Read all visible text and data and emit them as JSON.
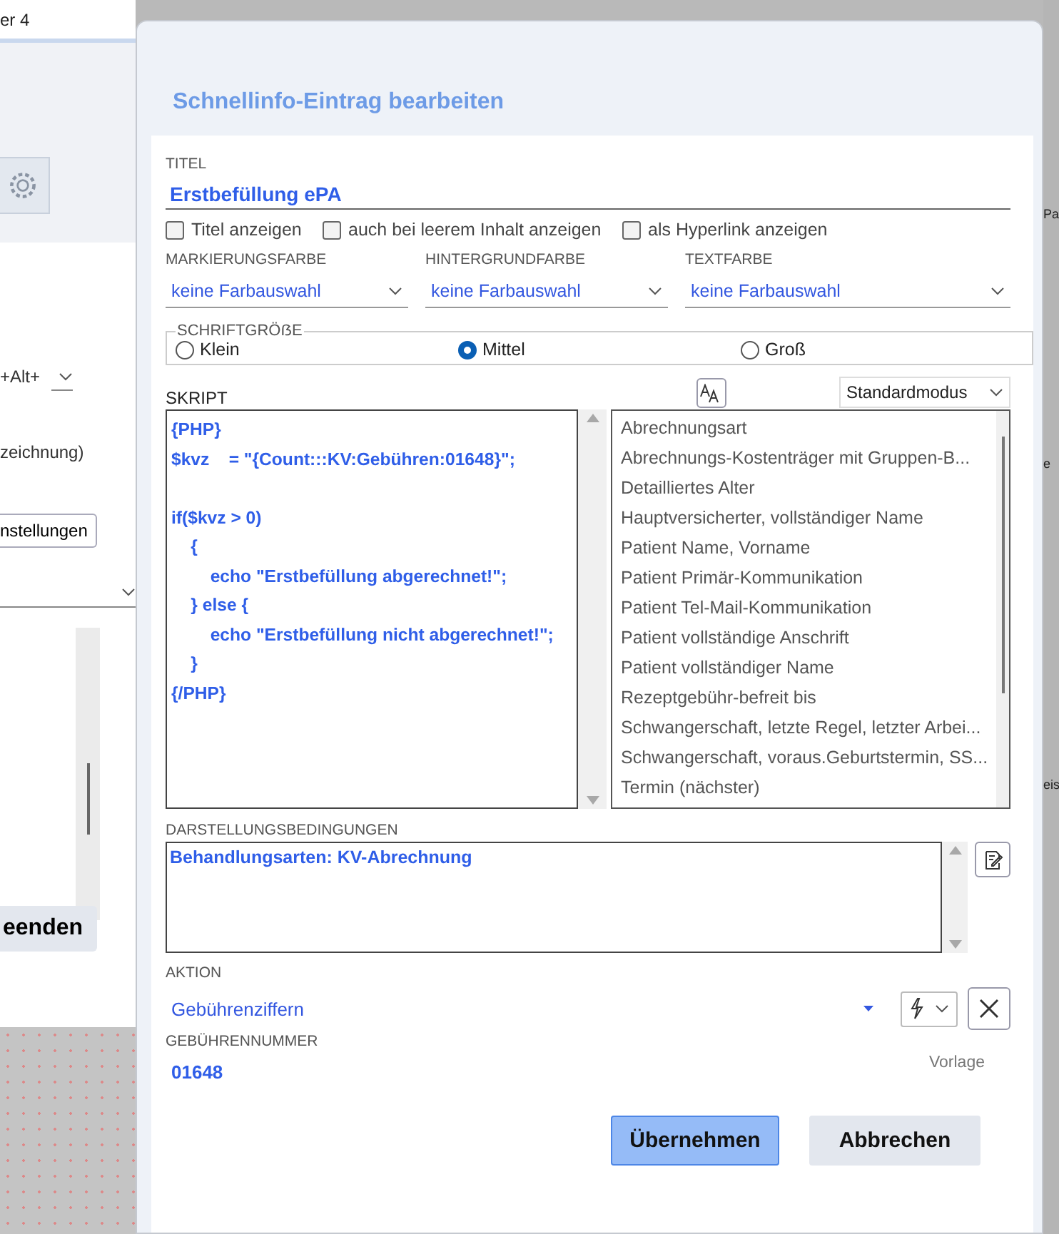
{
  "background_window": {
    "title": "er 4",
    "shortcut_label": "+Alt+",
    "label": "zeichnung)",
    "button": "nstellungen",
    "end_button": "eenden"
  },
  "right_edge_texts": [
    "Pa",
    "e",
    "eis"
  ],
  "dialog": {
    "title": "Schnellinfo-Eintrag bearbeiten",
    "titel": {
      "label": "TITEL",
      "value": "Erstbefüllung ePA"
    },
    "checkboxes": [
      {
        "label": "Titel anzeigen",
        "checked": false
      },
      {
        "label": "auch bei leerem Inhalt anzeigen",
        "checked": false
      },
      {
        "label": "als Hyperlink anzeigen",
        "checked": false
      }
    ],
    "color_selects": [
      {
        "label": "MARKIERUNGSFARBE",
        "value": "keine Farbauswahl"
      },
      {
        "label": "HINTERGRUNDFARBE",
        "value": "keine Farbauswahl"
      },
      {
        "label": "TEXTFARBE",
        "value": "keine Farbauswahl"
      }
    ],
    "font_size": {
      "label": "SCHRIFTGRÖẞE",
      "options": [
        {
          "label": "Klein",
          "selected": false
        },
        {
          "label": "Mittel",
          "selected": true
        },
        {
          "label": "Groß",
          "selected": false
        }
      ]
    },
    "script": {
      "label": "SKRIPT",
      "code": "{PHP}\n$kvz    = \"{Count:::KV:Gebühren:01648}\";\n\nif($kvz > 0)\n    {\n        echo \"Erstbefüllung abgerechnet!\";\n    } else {\n        echo \"Erstbefüllung nicht abgerechnet!\";\n    }\n{/PHP}"
    },
    "mode_select": {
      "value": "Standardmodus"
    },
    "placeholders": [
      "Abrechnungsart",
      "Abrechnungs-Kostenträger mit Gruppen-B...",
      "Detailliertes Alter",
      "Hauptversicherter, vollständiger Name",
      "Patient Name, Vorname",
      "Patient Primär-Kommunikation",
      "Patient Tel-Mail-Kommunikation",
      "Patient vollständige Anschrift",
      "Patient vollständiger Name",
      "Rezeptgebühr-befreit bis",
      "Schwangerschaft, letzte Regel, letzter Arbei...",
      "Schwangerschaft, voraus.Geburtstermin, SS...",
      "Termin (nächster)"
    ],
    "conditions": {
      "label": "DARSTELLUNGSBEDINGUNGEN",
      "value": "Behandlungsarten: KV-Abrechnung"
    },
    "action": {
      "label": "AKTION",
      "value": "Gebührenziffern"
    },
    "fee_number": {
      "label": "GEBÜHRENNUMMER",
      "value": "01648",
      "hint": "Vorlage"
    },
    "buttons": [
      {
        "label": "Übernehmen",
        "kind": "primary"
      },
      {
        "label": "Abbrechen",
        "kind": "secondary"
      }
    ]
  }
}
